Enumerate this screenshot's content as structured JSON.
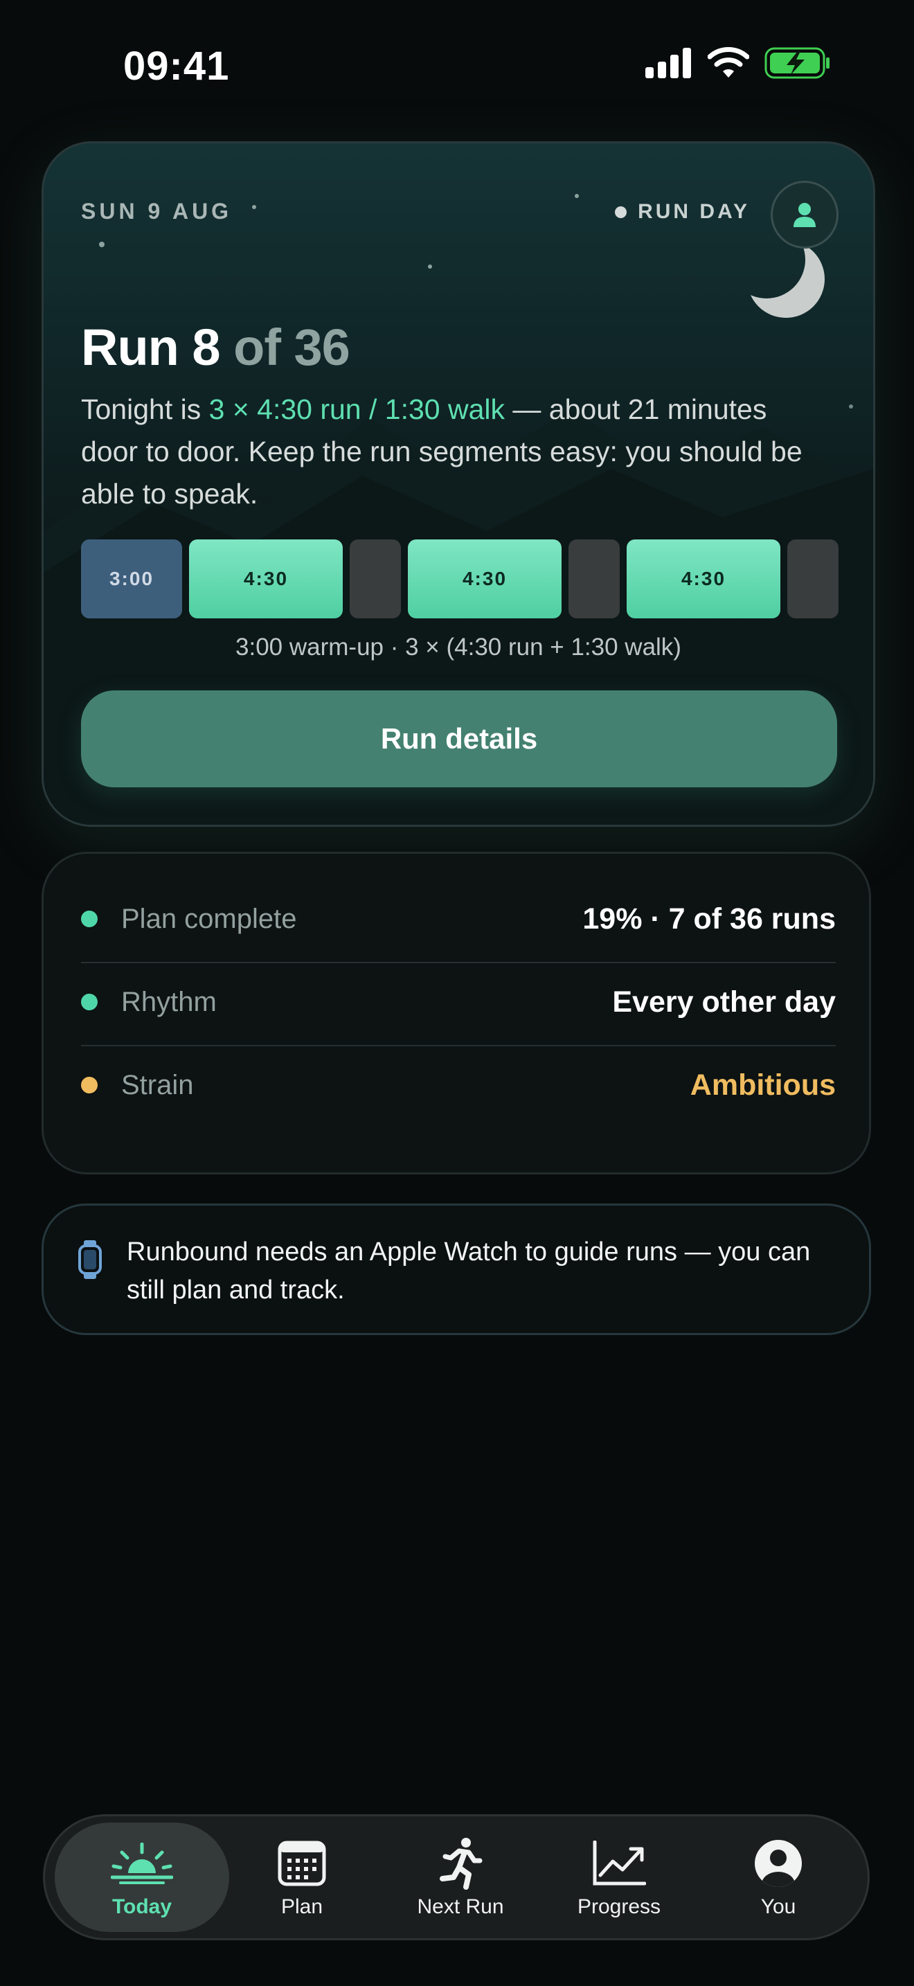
{
  "status_bar": {
    "time": "09:41"
  },
  "hero": {
    "date": "SUN 9 AUG",
    "day_type": "RUN DAY",
    "title_main": "Run 8",
    "title_muted": "of 36",
    "description_prefix": "Tonight is",
    "description_highlight": "3 × 4:30 run / 1:30 walk",
    "description_suffix": "— about 21 minutes door to door. Keep the run segments easy: you should be able to speak.",
    "segments": [
      {
        "kind": "warm",
        "label": "3:00"
      },
      {
        "kind": "run",
        "label": "4:30"
      },
      {
        "kind": "walk",
        "label": ""
      },
      {
        "kind": "run",
        "label": "4:30"
      },
      {
        "kind": "walk",
        "label": ""
      },
      {
        "kind": "run",
        "label": "4:30"
      },
      {
        "kind": "walk",
        "label": ""
      }
    ],
    "segments_caption": "3:00 warm-up · 3 × (4:30 run + 1:30 walk)",
    "cta_label": "Run details"
  },
  "stats": [
    {
      "label": "Plan complete",
      "value": "19% · 7 of 36 runs",
      "bullet_color": "#4fd6a8",
      "value_color": "#ffffff"
    },
    {
      "label": "Rhythm",
      "value": "Every other day",
      "bullet_color": "#4fd6a8",
      "value_color": "#ffffff"
    },
    {
      "label": "Strain",
      "value": "Ambitious",
      "bullet_color": "#f0bc60",
      "value_color": "#f0bc60"
    }
  ],
  "notice": {
    "icon": "apple-watch-icon",
    "text": "Runbound needs an Apple Watch to guide runs — you can still plan and track."
  },
  "tabs": [
    {
      "label": "Today",
      "icon": "sunrise-icon",
      "active": true
    },
    {
      "label": "Plan",
      "icon": "calendar-icon",
      "active": false
    },
    {
      "label": "Next Run",
      "icon": "runner-icon",
      "active": false
    },
    {
      "label": "Progress",
      "icon": "chart-line-icon",
      "active": false
    },
    {
      "label": "You",
      "icon": "person-circle-icon",
      "active": false
    }
  ],
  "colors": {
    "accent": "#5ee0b1",
    "cta": "#448170",
    "warm_segment": "#3e5f7c",
    "run_segment": "#5ed8ad",
    "walk_segment": "#3a3d3d",
    "warning": "#f0bc60",
    "battery": "#3fcf53"
  }
}
